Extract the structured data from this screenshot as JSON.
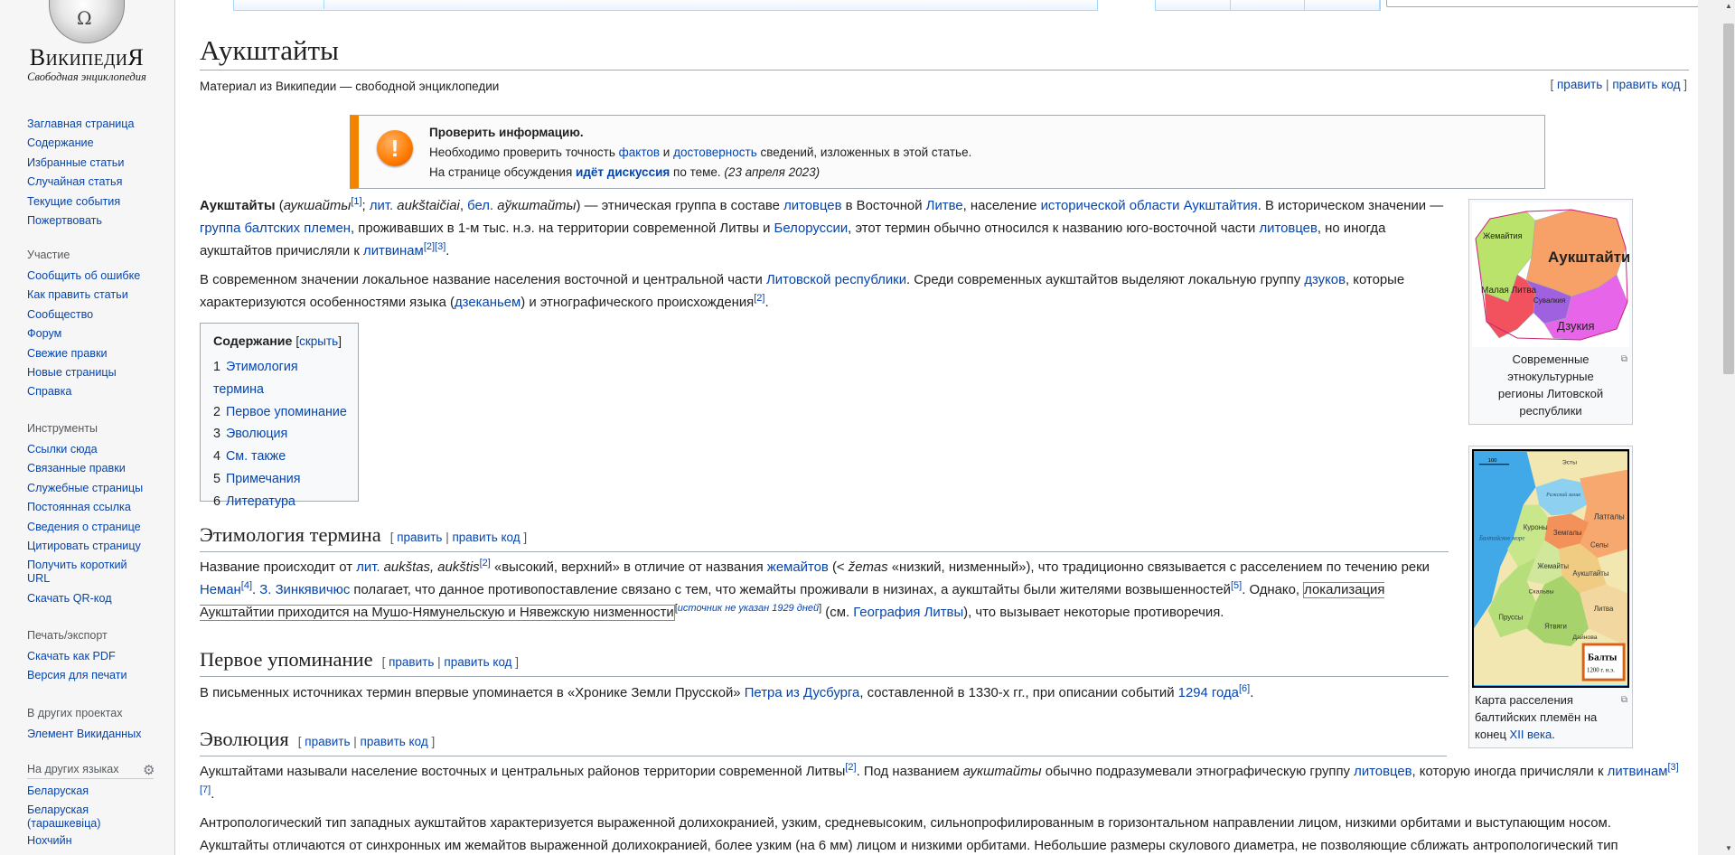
{
  "logo": {
    "wordmark": "ВикипедиЯ",
    "tagline": "Свободная энциклопедия",
    "globe_glyph": "Ω"
  },
  "nav": {
    "main": [
      "Заглавная страница",
      "Содержание",
      "Избранные статьи",
      "Случайная статья",
      "Текущие события",
      "Пожертвовать"
    ],
    "participation_title": "Участие",
    "participation": [
      "Сообщить об ошибке",
      "Как править статьи",
      "Сообщество",
      "Форум",
      "Свежие правки",
      "Новые страницы",
      "Справка"
    ],
    "tools_title": "Инструменты",
    "tools": [
      "Ссылки сюда",
      "Связанные правки",
      "Служебные страницы",
      "Постоянная ссылка",
      "Сведения о странице",
      "Цитировать страницу",
      "Получить короткий URL",
      "Скачать QR-код"
    ],
    "print_title": "Печать/экспорт",
    "print": [
      "Скачать как PDF",
      "Версия для печати"
    ],
    "projects_title": "В других проектах",
    "projects": [
      "Элемент Викиданных"
    ],
    "languages_title": "На других языках",
    "languages": [
      "Беларуская",
      "Беларуская (тарашкевіца)",
      "Нохчийн"
    ],
    "gear_icon": "⚙"
  },
  "page": {
    "title": "Аукштайты",
    "site_sub": "Материал из Википедии — свободной энциклопедии",
    "edit": "править",
    "edit_source": "править код",
    "sep": "|",
    "lb": "[",
    "rb": "]"
  },
  "ambox": {
    "icon_glyph": "!",
    "title": "Проверить информацию.",
    "line1_a": "Необходимо проверить точность ",
    "line1_link1": "фактов",
    "line1_b": " и ",
    "line1_link2": "достоверность",
    "line1_c": " сведений, изложенных в этой статье.",
    "line2_a": "На странице обсуждения ",
    "line2_link": "идёт дискуссия",
    "line2_b": " по теме. ",
    "line2_date": "(23 апреля 2023)"
  },
  "intro": {
    "p1": {
      "bold": "Аукштайты",
      "t1": " (",
      "i1": "аукшайты",
      "r1": "[1]",
      "t2": "; ",
      "l1": "лит.",
      "t3": " ",
      "i2": "aukštaičiai",
      "t4": ", ",
      "l2": "бел.",
      "t5": " ",
      "i3": "аўкштайты",
      "t6": ") — этническая группа в составе ",
      "l3": "литовцев",
      "t7": " в Восточной ",
      "l4": "Литве",
      "t8": ", население ",
      "l5": "исторической области Аукштайтия",
      "t9": ". В историческом значении — ",
      "l6": "группа балтских племен",
      "t10": ", проживавших в 1-м тыс. н.э. на территории современной Литвы и ",
      "l7": "Белоруссии",
      "t11": ", этот термин обычно относился к названию юго-восточной части ",
      "l8": "литовцев",
      "t12": ", но иногда аукштайтов причисляли к ",
      "l9": "литвинам",
      "r2": "[2]",
      "r3": "[3]",
      "t13": "."
    },
    "p2": {
      "t1": "В современном значении локальное название населения восточной и центральной части ",
      "l1": "Литовской республики",
      "t2": ". Среди современных аукштайтов выделяют локальную группу ",
      "l2": "дзуков",
      "t3": ", которые характеризуются особенностями языка (",
      "l3": "дзеканьем",
      "t4": ") и этнографического происхождения",
      "r1": "[2]",
      "t5": "."
    }
  },
  "toc": {
    "title": "Содержание",
    "hide": "скрыть",
    "items": [
      {
        "num": "1",
        "label": "Этимология термина"
      },
      {
        "num": "2",
        "label": "Первое упоминание"
      },
      {
        "num": "3",
        "label": "Эволюция"
      },
      {
        "num": "4",
        "label": "См. также"
      },
      {
        "num": "5",
        "label": "Примечания"
      },
      {
        "num": "6",
        "label": "Литература"
      }
    ]
  },
  "etym": {
    "heading": "Этимология термина",
    "t1": "Название происходит от ",
    "l1": "лит.",
    "t2": " ",
    "i1": "aukštas, aukštis",
    "r1": "[2]",
    "t3": " «высокий, верхний» в отличие от названия ",
    "l2": "жемайтов",
    "t4": " (< ",
    "i2": "žemas",
    "t5": " «низкий, низменный»), что традиционно связывается с расселением по течению реки ",
    "l3": "Неман",
    "r2": "[4]",
    "t6": ". ",
    "l4": "З. Зинкявичюс",
    "t7": " полагает, что данное противопоставление связано с тем, что жемайты проживали в низинах, а аукштайты были жителями возвышенностей",
    "r3": "[5]",
    "t8": ". Однако, ",
    "boxed": "локализация Аукштайтии приходится на Мушо-Нямунельскую и Нявежскую низменности",
    "cite_needed": "источник не указан 1929 дней",
    "t9": " (см. ",
    "l5": "География Литвы",
    "t10": "), что вызывает некоторые противоречия."
  },
  "first": {
    "heading": "Первое упоминание",
    "t1": "В письменных источниках термин впервые упоминается в «Хронике Земли Прусской» ",
    "l1": "Петра из Дусбурга",
    "t2": ", составленной в 1330-х гг., при описании событий ",
    "l2": "1294 года",
    "r1": "[6]",
    "t3": "."
  },
  "evol": {
    "heading": "Эволюция",
    "p1_t1": "Аукштайтами называли население восточных и центральных районов территории современной Литвы",
    "p1_r1": "[2]",
    "p1_t2": ". Под названием ",
    "p1_i1": "аукштайты",
    "p1_t3": " обычно подразумевали этнографическую группу ",
    "p1_l1": "литовцев",
    "p1_t4": ", которую иногда причисляли к ",
    "p1_l2": "литвинам",
    "p1_r2": "[3]",
    "p1_r3": "[7]",
    "p1_t5": ".",
    "p2": "Антропологический тип западных аукштайтов характеризуется выраженной долихокранией, узким, средневысоким, сильнопрофилированным в горизонтальном направлении лицом, низкими орбитами и выступающим носом. Аукштайты отличаются от синхронных им жемайтов выраженной долихокранией, более узким (на 6 мм) лицом и низкими орбитами. Небольшие размеры скулового диаметра, не позволяющие сближать антропологический тип"
  },
  "map1": {
    "labels": [
      "Жемайтия",
      "Аукштайтия",
      "Малая Литва",
      "Сувалкия",
      "Дзукия"
    ],
    "caption": "Современные этнокультурные регионы Литовской республики",
    "magnify_icon": "⧉"
  },
  "map2": {
    "labels": [
      "Эсты",
      "Латгалы",
      "Земгалы",
      "Селы",
      "Куроны",
      "Жемайты",
      "Аукштайты",
      "Скальвы",
      "Пруссы",
      "Ятвяги",
      "Дайнова",
      "Литва",
      "Балтийское море",
      "Рижский залив"
    ],
    "legend_title": "Балты",
    "legend_sub": "1200 г. н.э.",
    "scale": "100",
    "cap_t1": "Карта расселения балтийских племён на конец ",
    "cap_link": "XII века",
    "cap_t2": ".",
    "magnify_icon": "⧉"
  },
  "colors": {
    "link": "#0645ad",
    "warning": "#f28500",
    "border": "#a2a9b1"
  }
}
